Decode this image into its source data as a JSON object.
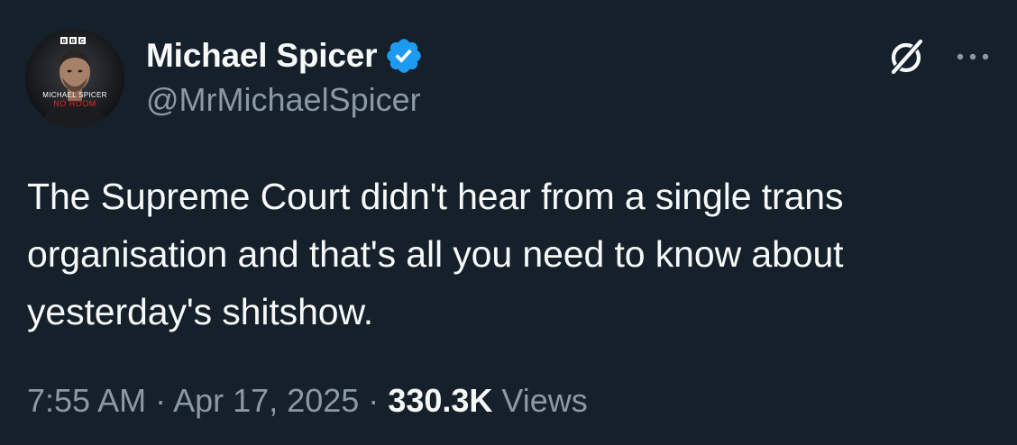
{
  "user": {
    "display_name": "Michael Spicer",
    "handle": "@MrMichaelSpicer",
    "verified": true,
    "avatar": {
      "badge_text": "BBC",
      "show_line1": "MICHAEL SPICER",
      "show_line2": "NO ROOM"
    }
  },
  "tweet": {
    "text": "The Supreme Court didn't hear from a single trans organisation and that's all you need to know about yesterday's shitshow.",
    "time": "7:55 AM",
    "separator": "·",
    "date": "Apr 17, 2025",
    "views_count": "330.3K",
    "views_label": "Views"
  },
  "icons": {
    "grok": "grok-icon",
    "more": "more-icon",
    "verified": "verified-badge-icon"
  },
  "colors": {
    "background": "#15202b",
    "text_primary": "#f7f9f9",
    "text_secondary": "#8b98a5",
    "verified_blue": "#1d9bf0",
    "show_title_red": "#e0282e"
  }
}
